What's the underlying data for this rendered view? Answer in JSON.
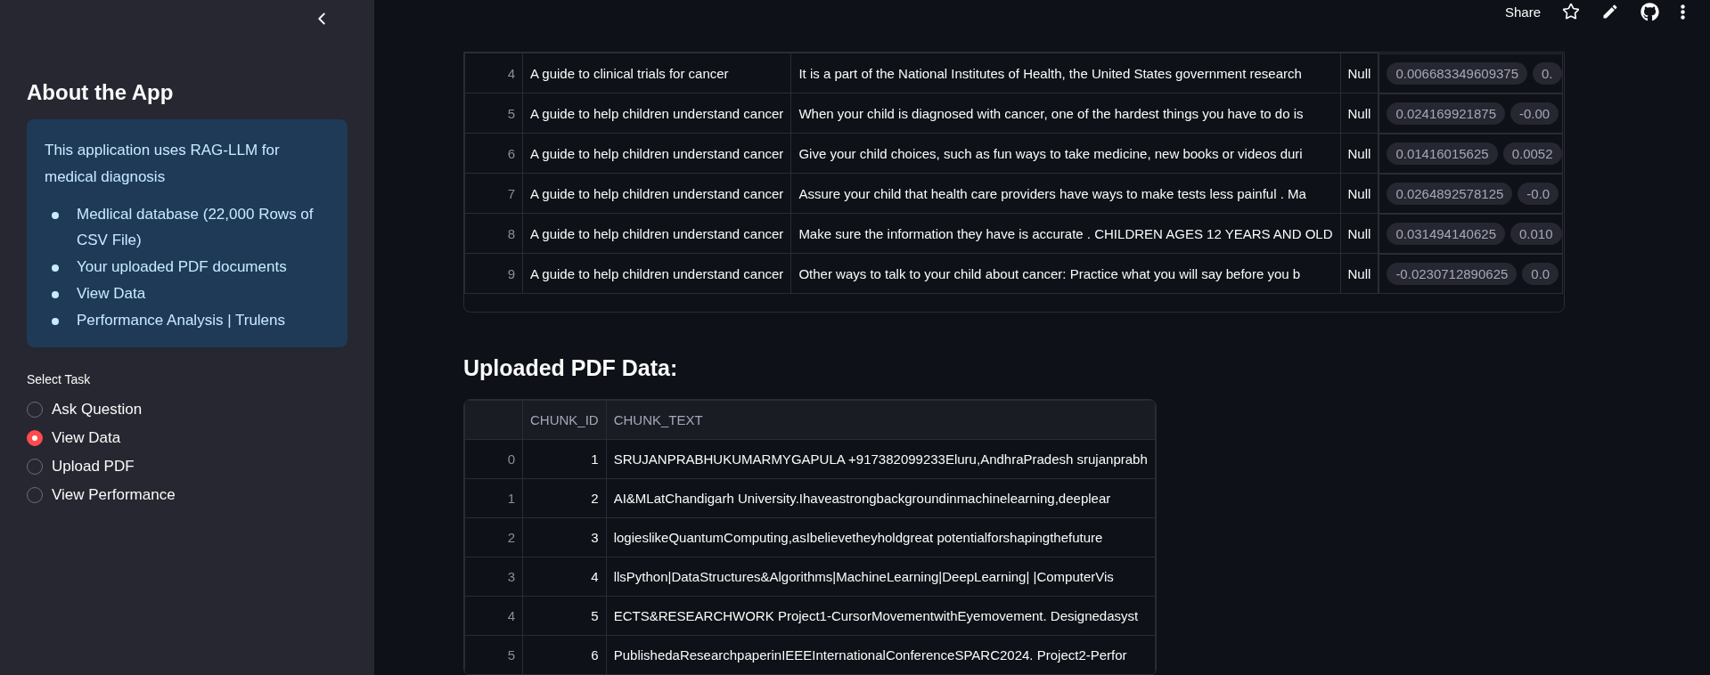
{
  "header": {
    "share": "Share"
  },
  "sidebar": {
    "about_title": "About the App",
    "info": {
      "text": "This application uses RAG-LLM for medical diagnosis",
      "items": [
        "Medlical database (22,000 Rows of CSV File)",
        "Your uploaded PDF documents",
        "View Data",
        "Performance Analysis | Trulens"
      ]
    },
    "task_label": "Select Task",
    "tasks": [
      {
        "label": "Ask Question",
        "selected": false
      },
      {
        "label": "View Data",
        "selected": true
      },
      {
        "label": "Upload PDF",
        "selected": false
      },
      {
        "label": "View Performance",
        "selected": false
      }
    ]
  },
  "records_table": {
    "rows": [
      {
        "index": "4",
        "title": "A guide to clinical trials for cancer",
        "text": "It is a part of the National Institutes of Health, the United States government research",
        "status": "Null",
        "embedding": [
          "0.006683349609375",
          "0."
        ]
      },
      {
        "index": "5",
        "title": "A guide to help children understand cancer",
        "text": "When your child is diagnosed with cancer, one of the hardest things you have to do is",
        "status": "Null",
        "embedding": [
          "0.024169921875",
          "-0.00"
        ]
      },
      {
        "index": "6",
        "title": "A guide to help children understand cancer",
        "text": "Give your child choices, such as fun ways to take medicine, new books or videos duri",
        "status": "Null",
        "embedding": [
          "0.01416015625",
          "0.0052"
        ]
      },
      {
        "index": "7",
        "title": "A guide to help children understand cancer",
        "text": "Assure your child that health care providers have ways to make tests less painful . Ma",
        "status": "Null",
        "embedding": [
          "0.0264892578125",
          "-0.0"
        ]
      },
      {
        "index": "8",
        "title": "A guide to help children understand cancer",
        "text": "Make sure the information they have is accurate . CHILDREN AGES 12 YEARS AND OLD",
        "status": "Null",
        "embedding": [
          "0.031494140625",
          "0.010"
        ]
      },
      {
        "index": "9",
        "title": "A guide to help children understand cancer",
        "text": "Other ways to talk to your child about cancer: Practice what you will say before you b",
        "status": "Null",
        "embedding": [
          "-0.0230712890625",
          "0.0"
        ]
      }
    ]
  },
  "pdf_section": {
    "title": "Uploaded PDF Data:",
    "table": {
      "columns": [
        "CHUNK_ID",
        "CHUNK_TEXT"
      ],
      "rows": [
        {
          "index": "0",
          "chunk_id": "1",
          "chunk_text": "SRUJANPRABHUKUMARMYGAPULA +917382099233Eluru,AndhraPradesh srujanprabh"
        },
        {
          "index": "1",
          "chunk_id": "2",
          "chunk_text": "AI&MLatChandigarh University.Ihaveastrongbackgroundinmachinelearning,deeplear"
        },
        {
          "index": "2",
          "chunk_id": "3",
          "chunk_text": "logieslikeQuantumComputing,asIbelievetheyholdgreat potentialforshapingthefuture"
        },
        {
          "index": "3",
          "chunk_id": "4",
          "chunk_text": "llsPython|DataStructures&Algorithms|MachineLearning|DeepLearning| |ComputerVis"
        },
        {
          "index": "4",
          "chunk_id": "5",
          "chunk_text": "ECTS&RESEARCHWORK Project1-CursorMovementwithEyemovement. Designedasyst"
        },
        {
          "index": "5",
          "chunk_id": "6",
          "chunk_text": "PublishedaResearchpaperinIEEEInternationalConferenceSPARC2024. Project2-Perfor"
        }
      ]
    }
  }
}
